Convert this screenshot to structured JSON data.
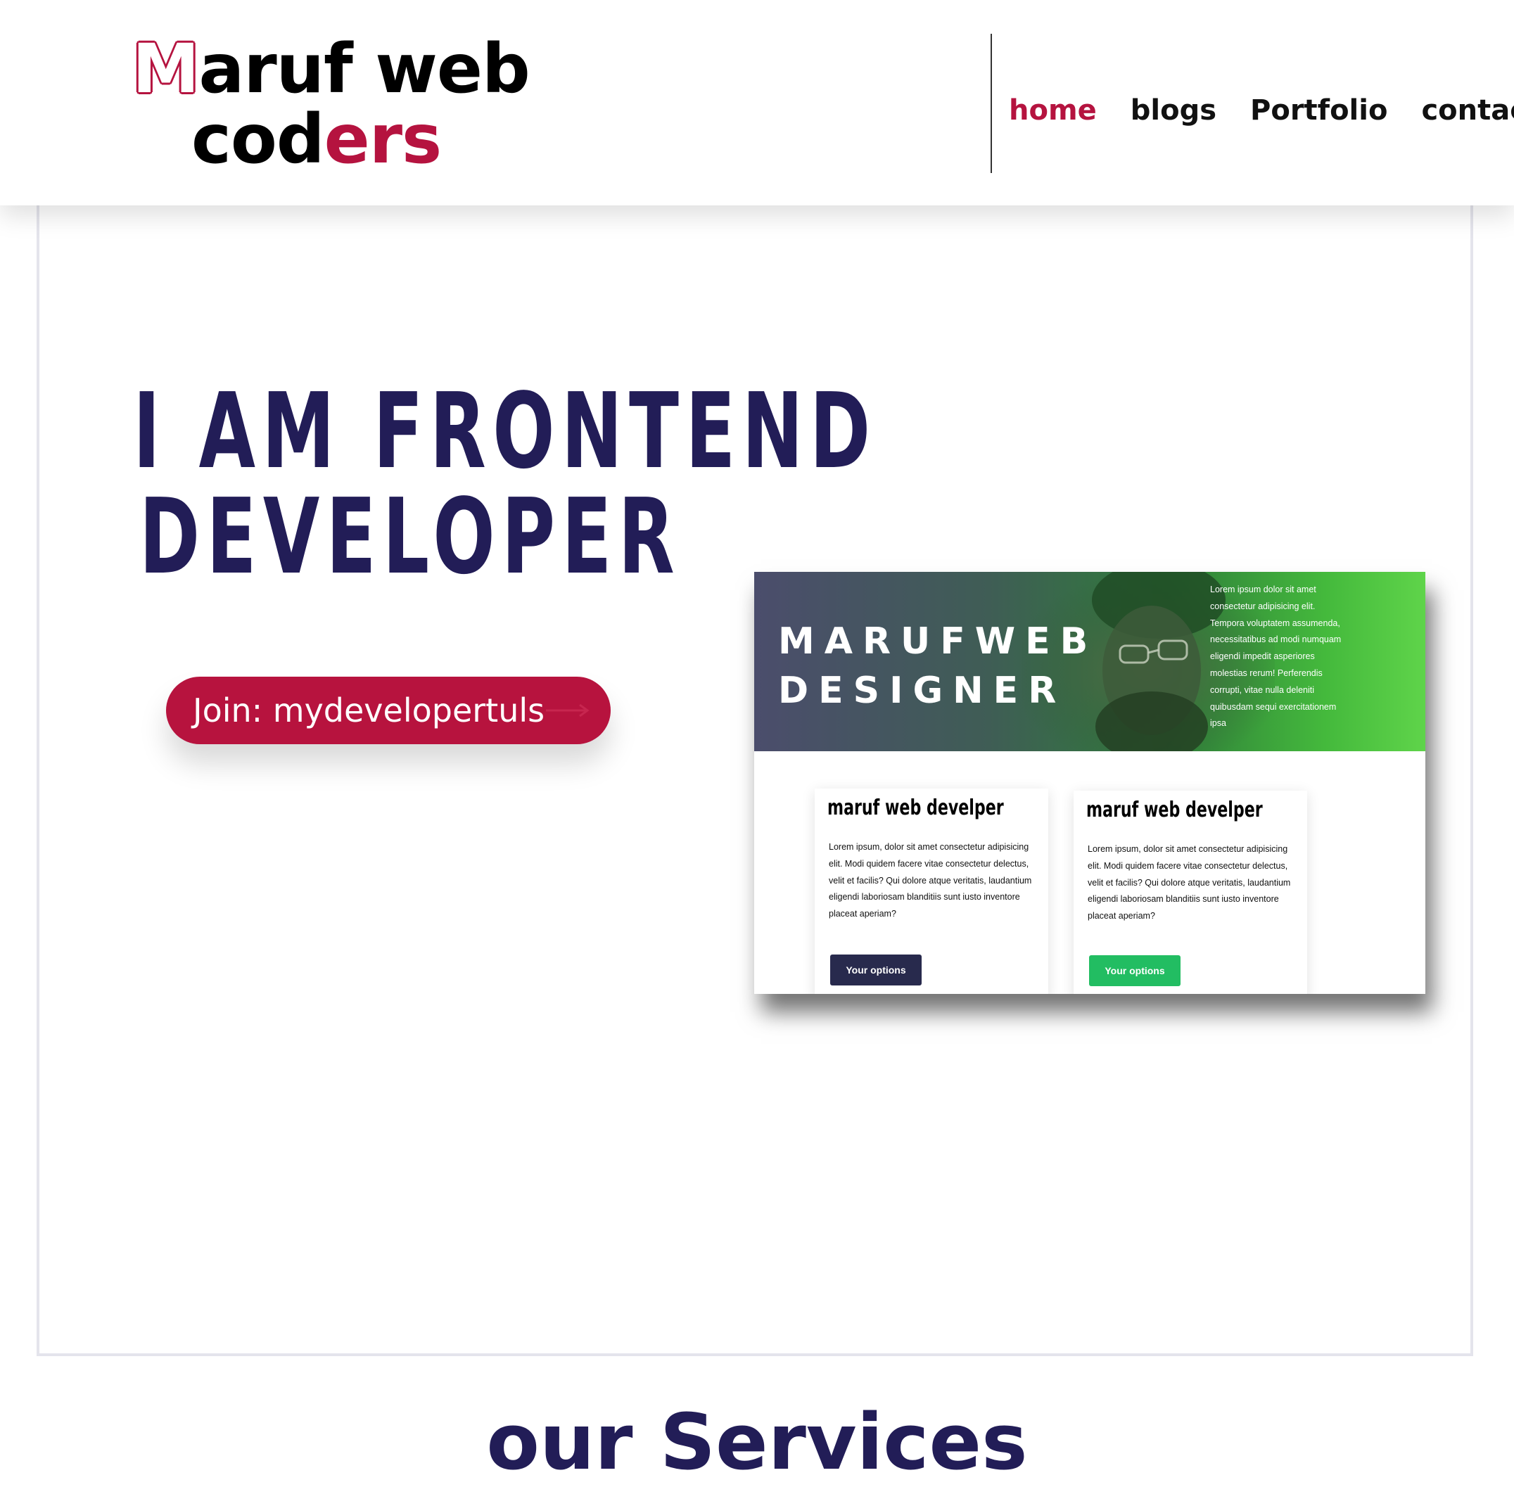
{
  "header": {
    "logo": {
      "line1_initial": "M",
      "line1_rest": "aruf web",
      "line2_plain": "cod",
      "line2_accent": "ers"
    },
    "nav": [
      {
        "label": "home",
        "active": true
      },
      {
        "label": "blogs",
        "active": false
      },
      {
        "label": "Portfolio",
        "active": false
      },
      {
        "label": "contact",
        "active": false
      }
    ]
  },
  "hero": {
    "title_line1": "I AM FRONTEND",
    "title_line2": "DEVELOPER",
    "cta_label": "Join: mydevelopertuls"
  },
  "preview": {
    "brand_line1": "MARUFWEB",
    "brand_line2": "DESIGNER",
    "banner_text": "Lorem ipsum dolor sit amet consectetur adipisicing elit. Tempora voluptatem assumenda, necessitatibus ad modi numquam eligendi impedit asperiores molestias rerum! Perferendis corrupti, vitae nulla deleniti quibusdam sequi exercitationem ipsa",
    "cards": [
      {
        "title": "maruf web develper",
        "body": "Lorem ipsum, dolor sit amet consectetur adipisicing elit. Modi quidem facere vitae consectetur delectus, velit et facilis? Qui dolore atque veritatis, laudantium eligendi laboriosam blanditiis sunt iusto inventore placeat aperiam?",
        "button": "Your options"
      },
      {
        "title": "maruf web develper",
        "body": "Lorem ipsum, dolor sit amet consectetur adipisicing elit. Modi quidem facere vitae consectetur delectus, velit et facilis? Qui dolore atque veritatis, laudantium eligendi laboriosam blanditiis sunt iusto inventore placeat aperiam?",
        "button": "Your options"
      }
    ]
  },
  "services": {
    "title": "our Services"
  },
  "colors": {
    "accent": "#b5133f",
    "navy": "#221d57",
    "green": "#22bd62",
    "dark_button": "#282a4d"
  },
  "icons": {
    "cta_arrow": "arrow-right-icon"
  }
}
